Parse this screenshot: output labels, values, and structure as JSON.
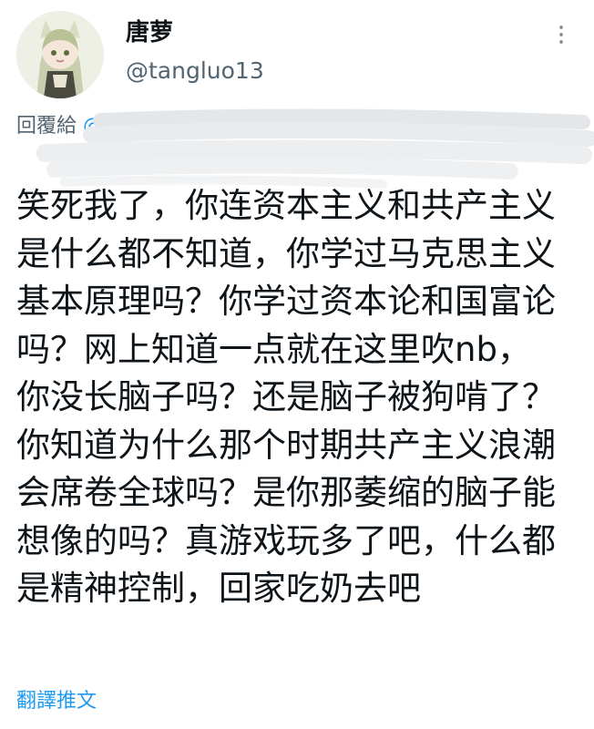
{
  "author": {
    "display_name": "唐萝",
    "handle": "@tangluo13",
    "avatar_icon": "anime-avatar-icon"
  },
  "menu": {
    "more_icon": "more-vertical-icon"
  },
  "reply": {
    "prefix": "回覆給",
    "target": "@"
  },
  "tweet": {
    "lines": [
      "笑死我了，你连资本主义和共产主义",
      "是什么都不知道，你学过马克思主义",
      "基本原理吗？你学过资本论和国富论",
      "吗？网上知道一点就在这里吹nb，",
      "你没长脑子吗？还是脑子被狗啃了？",
      "你知道为什么那个时期共产主义浪潮",
      "会席卷全球吗？是你那萎缩的脑子能",
      "想像的吗？真游戏玩多了吧，什么都",
      "是精神控制，回家吃奶去吧"
    ]
  },
  "actions": {
    "translate_label": "翻譯推文"
  },
  "colors": {
    "text": "#0f1419",
    "secondary": "#536471",
    "link": "#1d9bf0"
  }
}
